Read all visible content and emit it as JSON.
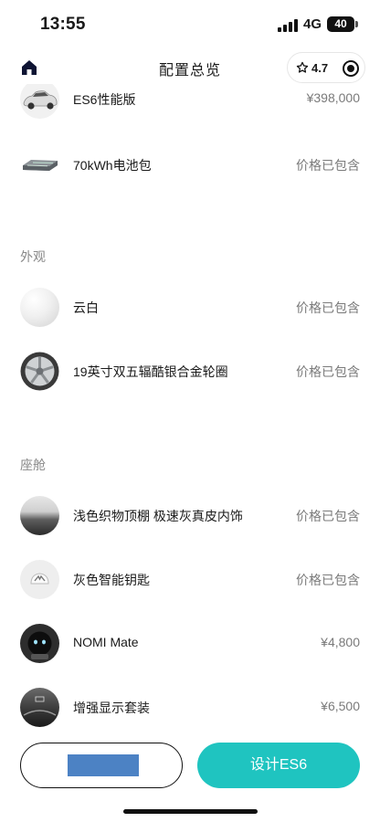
{
  "status_bar": {
    "time": "13:55",
    "network": "4G",
    "battery": "40"
  },
  "nav": {
    "title": "配置总览",
    "rating": "4.7"
  },
  "items": {
    "model": {
      "name": "ES6性能版",
      "price": "¥398,000"
    },
    "battery_pack": {
      "name": "70kWh电池包",
      "price": "价格已包含"
    }
  },
  "exterior": {
    "title": "外观",
    "color": {
      "name": "云白",
      "price": "价格已包含"
    },
    "wheels": {
      "name": "19英寸双五辐酷银合金轮圈",
      "price": "价格已包含"
    }
  },
  "cabin": {
    "title": "座舱",
    "interior": {
      "name": "浅色织物顶棚 极速灰真皮内饰",
      "price": "价格已包含"
    },
    "key": {
      "name": "灰色智能钥匙",
      "price": "价格已包含"
    },
    "nomi": {
      "name": "NOMI Mate",
      "price": "¥4,800"
    },
    "hud": {
      "name": "增强显示套装",
      "price": "¥6,500"
    }
  },
  "bottom": {
    "design_button": "设计ES6"
  },
  "colors": {
    "accent": "#1fc4c0",
    "redaction": "#4c82c4"
  },
  "icons": {
    "home": "home-icon",
    "star": "star-outline-icon",
    "target": "target-icon"
  }
}
